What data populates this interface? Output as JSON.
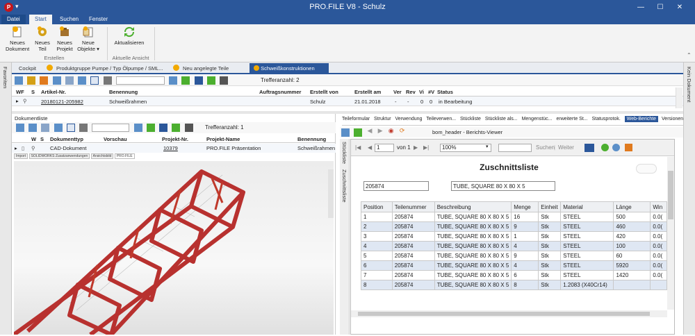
{
  "window": {
    "title": "PRO.FILE V8 - Schulz",
    "qat": "▾"
  },
  "ribbon_tabs": [
    "Datei",
    "Start",
    "Suchen",
    "Fenster"
  ],
  "ribbon": {
    "buttons": [
      "Neues\nDokument",
      "Neues\nTeil",
      "Neues\nProjekt",
      "Neue\nObjekte ▾",
      "Aktualisieren"
    ],
    "groups": [
      "Erstellen",
      "Aktuelle Ansicht"
    ]
  },
  "side": {
    "left": "Favoriten",
    "right": "Kein Dokument"
  },
  "doc_tabs": [
    "Cockpit",
    "Produktgruppe Pumpe / Typ Ölpumpe / SML...",
    "Neu angelegte Teile",
    "Schweißkonstruktionen"
  ],
  "top_panel": {
    "hits": "Trefferanzahl: 2",
    "columns": [
      "WF",
      "S",
      "Artikel-Nr.",
      "Benennung",
      "Auftragsnummer",
      "Erstellt von",
      "Erstellt am",
      "Ver",
      "Rev",
      "Vi",
      "#V",
      "Status"
    ],
    "row": {
      "artikel": "20180121-205982",
      "benennung": "Schweißrahmen",
      "auftrag": "",
      "erstellt_von": "Schulz",
      "erstellt_am": "21.01.2018",
      "ver": "-",
      "rev": "-",
      "vi": "0",
      "v": "0",
      "status": "in Bearbeitung"
    }
  },
  "doc_list": {
    "title": "Dokumentliste",
    "hits": "Trefferanzahl: 1",
    "columns": [
      "W",
      "S",
      "Dokumenttyp",
      "Vorschau",
      "Projekt-Nr.",
      "Projekt-Name",
      "Benennung"
    ],
    "row": {
      "typ": "CAD-Dokument",
      "projekt_nr": "10379",
      "projekt_name": "PRO.FILE Präsentation",
      "benennung": "Schweißrahmen"
    },
    "viewer_tabs": [
      "Import",
      "SOLIDWORKS Zusatzanwendungen",
      "Ansichtsbild",
      "PRO.FILE"
    ]
  },
  "right_tabs": [
    "Teileformular",
    "Struktur",
    "Verwendung",
    "Teileverwen...",
    "Stückliste",
    "Stückliste als...",
    "Mengenstüc...",
    "erweiterte St...",
    "Statusprotok.",
    "Web-Berichte",
    "Versionen"
  ],
  "report": {
    "header": "bom_header - Berichts-Viewer",
    "side_tabs": [
      "Stückliste",
      "Zuschnittsliste"
    ],
    "page": "1",
    "of": "von 1",
    "zoom": "100%",
    "search_label": "Suchen",
    "next_label": "Weiter",
    "title": "Zuschnittsliste",
    "part_number": "205874",
    "part_name": "TUBE, SQUARE 80 X 80 X 5",
    "columns": [
      "Position",
      "Teilenummer",
      "Beschreibung",
      "Menge",
      "Einheit",
      "Material",
      "Länge",
      "Win"
    ],
    "rows": [
      [
        "1",
        "205874",
        "TUBE, SQUARE 80 X 80 X 5",
        "16",
        "Stk",
        "STEEL",
        "500",
        "0.0("
      ],
      [
        "2",
        "205874",
        "TUBE, SQUARE 80 X 80 X 5",
        "9",
        "Stk",
        "STEEL",
        "460",
        "0.0("
      ],
      [
        "3",
        "205874",
        "TUBE, SQUARE 80 X 80 X 5",
        "1",
        "Stk",
        "STEEL",
        "420",
        "0.0("
      ],
      [
        "4",
        "205874",
        "TUBE, SQUARE 80 X 80 X 5",
        "4",
        "Stk",
        "STEEL",
        "100",
        "0.0("
      ],
      [
        "5",
        "205874",
        "TUBE, SQUARE 80 X 80 X 5",
        "9",
        "Stk",
        "STEEL",
        "60",
        "0.0("
      ],
      [
        "6",
        "205874",
        "TUBE, SQUARE 80 X 80 X 5",
        "4",
        "Stk",
        "STEEL",
        "5920",
        "0.0("
      ],
      [
        "7",
        "205874",
        "TUBE, SQUARE 80 X 80 X 5",
        "6",
        "Stk",
        "STEEL",
        "1420",
        "0.0("
      ],
      [
        "8",
        "205874",
        "TUBE, SQUARE 80 X 80 X 5",
        "8",
        "Stk",
        "1.2083 (X40Cr14)",
        "",
        ""
      ]
    ]
  },
  "colors": {
    "accent": "#2b579a",
    "frame": "#b8312f",
    "row_alt": "#dfe7f3"
  }
}
